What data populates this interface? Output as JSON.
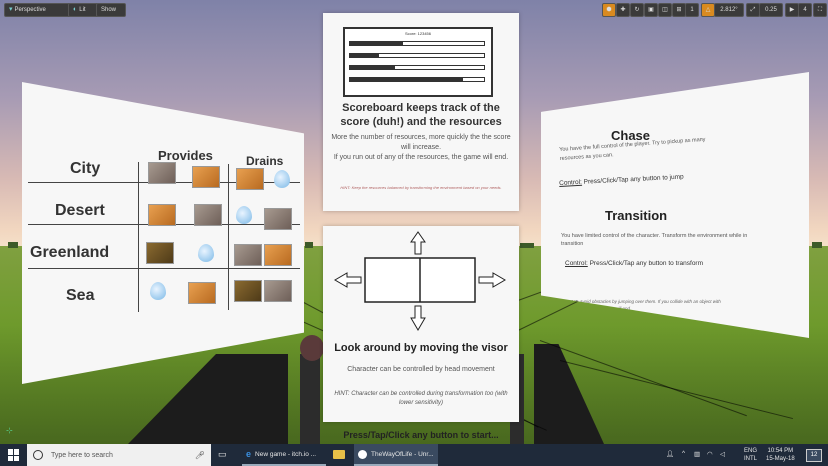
{
  "toolbar": {
    "perspective": "Perspective",
    "lit": "Lit",
    "show": "Show",
    "angle_value": "2.812°",
    "scale_value": "0.25",
    "grid_value": "1",
    "camera_speed": "4"
  },
  "left_panel": {
    "provides": "Provides",
    "drains": "Drains",
    "rows": [
      "City",
      "Desert",
      "Greenland",
      "Sea"
    ]
  },
  "scoreboard": {
    "chart_label": "Score: 123456",
    "title": "Scoreboard keeps track of the score (duh!) and the resources",
    "body": "More the number of resources, more quickly the the score will increase.\nIf you run out of any of the resources, the game will end.",
    "hint": "HINT: Keep the resources balanced by transforming the environment based on your needs."
  },
  "visor_panel": {
    "title": "Look around by moving the visor",
    "body": "Character can be controlled by head movement",
    "hint": "HINT: Character can be controlled during transformation too (with lower sensitivity)"
  },
  "right_panel": {
    "chase_title": "Chase",
    "chase_body": "You have the full control of the player. Try to pickup as many resources as you can.",
    "chase_control_label": "Control:",
    "chase_control": "Press/Click/Tap any button to jump",
    "transition_title": "Transition",
    "transition_body": "You have limited control of the character. Transform the environment while in transition",
    "transition_control_label": "Control:",
    "transition_control": "Press/Click/Tap any button to transform",
    "hint": "HINT: Avoid obstacles by jumping over them. If you collide with an object with greater force, the game will end."
  },
  "start_prompt": "Press/Tap/Click any button to start...",
  "taskbar": {
    "search_placeholder": "Type here to search",
    "app1": "New game - itch.io ...",
    "app2": "TheWayOfLife - Unr...",
    "lang1": "ENG",
    "lang2": "INTL",
    "time": "10:54 PM",
    "date": "15-May-18",
    "notif_count": "12"
  }
}
